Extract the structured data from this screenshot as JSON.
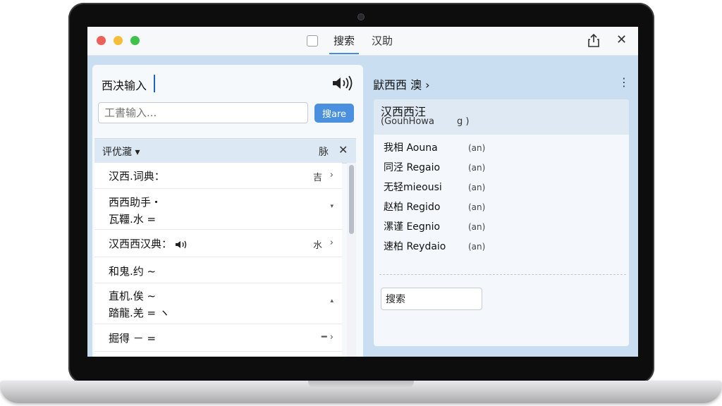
{
  "window": {
    "tabs": [
      "搜索",
      "汉助"
    ],
    "active_tab": "搜索"
  },
  "left": {
    "title": "西决输入",
    "search": {
      "placeholder": "工書输入...",
      "button_label": "搜are"
    },
    "filter": {
      "label": "评优瀧 ▾",
      "icon_text": "脉"
    },
    "rows": [
      {
        "line1": "汉西.词典：",
        "side": "吉",
        "arrow": "›"
      },
      {
        "line1": "西西助手・",
        "line2": "瓦韁.水 =",
        "side": "",
        "arrow": "▾"
      },
      {
        "line1": "汉西西汉典：",
        "speaker": true,
        "side": "水",
        "arrow": "›"
      },
      {
        "line1": "和鬼.约 ~",
        "side": "",
        "arrow": ""
      },
      {
        "line1": "直机.俟 ~",
        "line2": "踏龍.羌 = ヽ",
        "side": "",
        "arrow": "▴"
      },
      {
        "line1": "掘得 － =",
        "side": "",
        "arrow": "━ ›"
      }
    ]
  },
  "right": {
    "header": "鼣西西 澳 ›",
    "more": "⋮",
    "highlight": {
      "title": "汉西西汪",
      "sub": "(GouhHowa",
      "sub2": "g )"
    },
    "entries": [
      {
        "word": "我相 Aouna",
        "pos": "(an)"
      },
      {
        "word": "同泾 Regaio",
        "pos": "(an)"
      },
      {
        "word": "无轻mieousi",
        "pos": "(an)"
      },
      {
        "word": "赵柏 Regido",
        "pos": "(an)"
      },
      {
        "word": "漯谨 Eegnio",
        "pos": "(an)"
      },
      {
        "word": "速柏 Reydaio",
        "pos": "(an)"
      }
    ],
    "search_value": "搜索"
  },
  "colors": {
    "accent": "#4a90de",
    "pane_bg": "#c9def1",
    "close_red": "#ee5f58",
    "min_yellow": "#f6bd3b",
    "max_green": "#3fc24c"
  }
}
